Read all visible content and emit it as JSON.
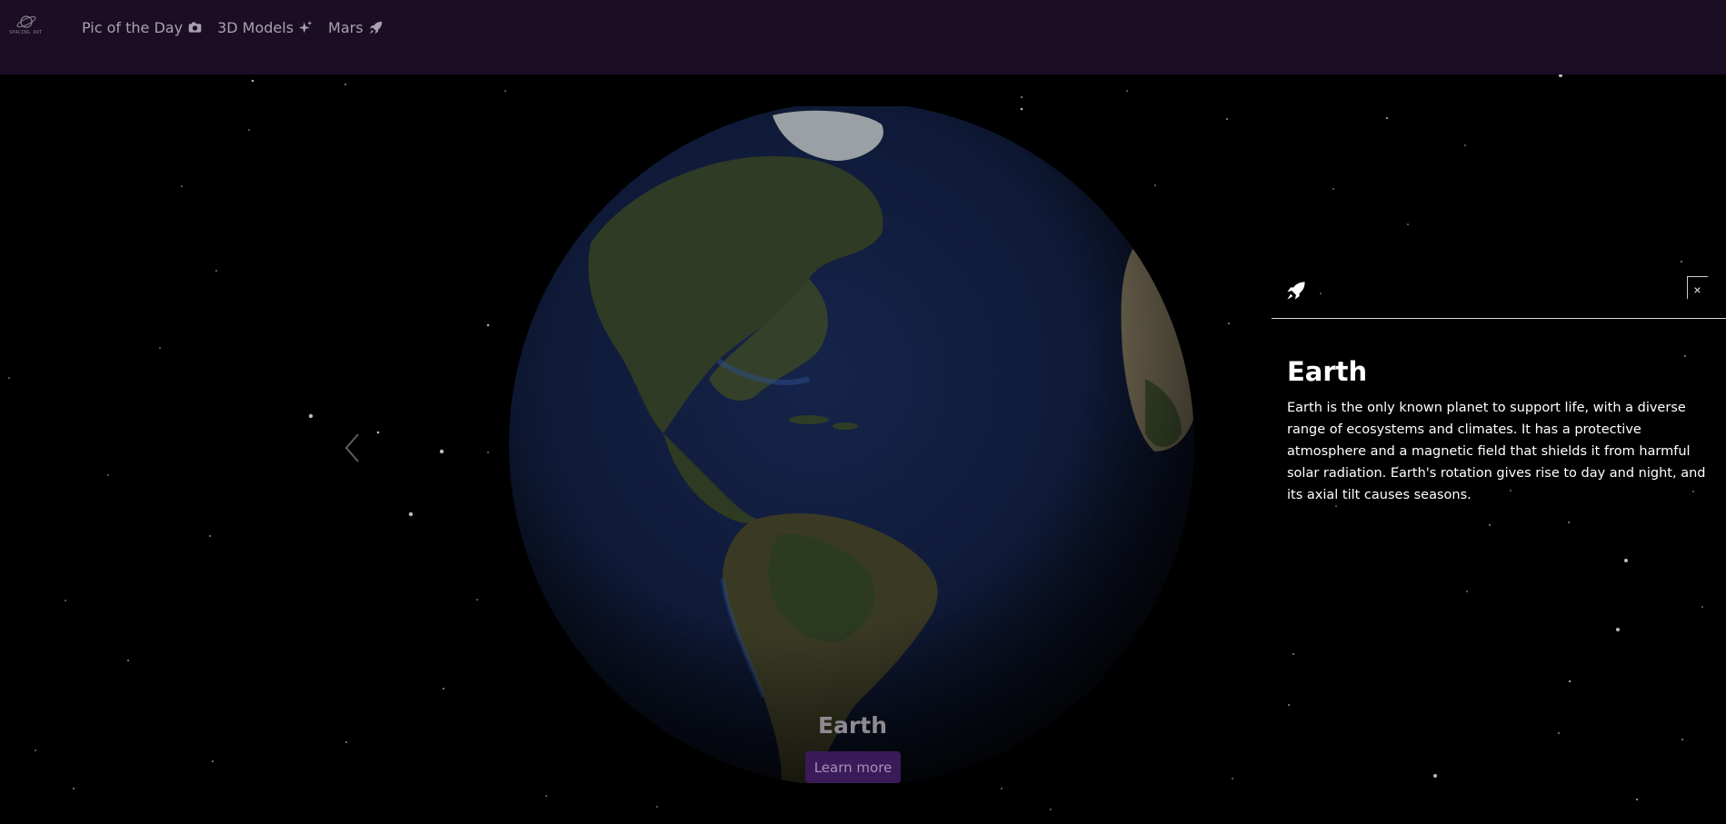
{
  "logo": {
    "text": "SPACING OUT"
  },
  "nav": {
    "items": [
      {
        "label": "Pic of the Day",
        "icon": "camera-icon"
      },
      {
        "label": "3D Models",
        "icon": "sparkles-icon"
      },
      {
        "label": "Mars",
        "icon": "rocket-icon"
      }
    ]
  },
  "carousel": {
    "planet_name": "Earth",
    "learn_more_label": "Learn more",
    "prev_icon": "chevron-left-icon"
  },
  "info_panel": {
    "icon": "rocket-icon",
    "close_label": "×",
    "title": "Earth",
    "description": "Earth is the only known planet to support life, with a diverse range of ecosystems and climates. It has a protective atmosphere and a magnetic field that shields it from harmful solar radiation. Earth's rotation gives rise to day and night, and its axial tilt causes seasons."
  },
  "colors": {
    "navbar_bg": "#1a0d24",
    "page_bg": "#000000",
    "accent_button": "#3a1a59",
    "nav_text": "#a8a1ae"
  }
}
